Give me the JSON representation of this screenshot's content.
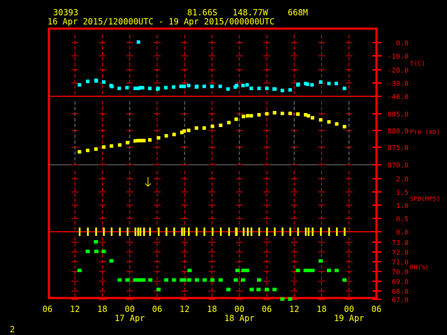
{
  "header": {
    "station": "30393",
    "lat": "81.66S",
    "lon": "148.77W",
    "elev": "668M",
    "period": "16 Apr 2015/120000UTC - 19 Apr 2015/000000UTC"
  },
  "footer": {
    "page": "2"
  },
  "colors": {
    "frame": "#ff0000",
    "temp": "#00ffff",
    "pressure": "#ffff00",
    "wind": "#ffff00",
    "rh": "#00ff00",
    "text": "#ffff00"
  },
  "chart_data": {
    "type": "scatter",
    "title": "30393  81.66S 148.77W 668M",
    "subtitle": "16 Apr 2015/120000UTC - 19 Apr 2015/000000UTC",
    "x_unit": "hours since 16 Apr 2015 06 UTC",
    "xlim": [
      0,
      72
    ],
    "x_ticks": [
      "06",
      "12",
      "18",
      "00",
      "06",
      "12",
      "18",
      "00",
      "06",
      "12",
      "18",
      "00",
      "06"
    ],
    "x_dates": [
      {
        "label": "17 Apr",
        "hour": 18
      },
      {
        "label": "18 Apr",
        "hour": 42
      },
      {
        "label": "19 Apr",
        "hour": 66
      }
    ],
    "panels": [
      {
        "name": "temperature",
        "label": "T(C)",
        "ylim": [
          -40,
          0
        ],
        "y_ticks": [
          "0.0",
          "-10.0",
          "-20.0",
          "-30.0",
          "-40.0"
        ],
        "x": [
          7.0,
          8.8,
          10.6,
          10.7,
          12.3,
          13.9,
          14.1,
          15.7,
          17.4,
          19.2,
          19.9,
          20.3,
          20.8,
          22.4,
          24.1,
          24.2,
          25.9,
          27.6,
          29.2,
          29.9,
          30.9,
          32.6,
          32.7,
          34.3,
          36.0,
          37.8,
          39.5,
          41.1,
          41.4,
          42.8,
          43.7,
          44.6,
          46.3,
          48.0,
          49.6,
          49.8,
          51.4,
          53.1,
          54.8,
          54.9,
          56.5,
          56.9,
          57.9,
          59.8,
          61.6,
          63.2,
          65.0,
          19.9
        ],
        "y": [
          -31.5,
          -28.9,
          -28.1,
          -28.6,
          -29.4,
          -32.0,
          -32.7,
          -34.1,
          -33.6,
          -34.1,
          -34.1,
          -33.6,
          -33.6,
          -34.1,
          -34.6,
          -34.1,
          -33.6,
          -33.1,
          -32.6,
          -32.6,
          -32.0,
          -33.1,
          -32.6,
          -32.6,
          -32.6,
          -32.6,
          -34.6,
          -33.1,
          -32.0,
          -32.0,
          -31.5,
          -34.1,
          -34.1,
          -34.1,
          -34.6,
          -34.6,
          -35.7,
          -35.2,
          -31.5,
          -31.0,
          -30.5,
          -31.0,
          -31.5,
          -29.4,
          -30.5,
          -30.5,
          -34.1,
          0.4
        ]
      },
      {
        "name": "pressure",
        "label": "Pre (mb)",
        "ylim": [
          870,
          888
        ],
        "y_ticks": [
          "885.0",
          "880.0",
          "875.0",
          "870.0"
        ],
        "x": [
          7.0,
          8.8,
          10.6,
          12.3,
          14.0,
          15.8,
          17.5,
          19.2,
          19.8,
          20.3,
          20.7,
          21.1,
          22.4,
          24.3,
          26.0,
          27.7,
          29.4,
          29.9,
          30.9,
          32.6,
          34.3,
          36.1,
          37.9,
          39.7,
          41.3,
          42.9,
          43.8,
          44.6,
          46.3,
          48.0,
          49.7,
          51.4,
          53.1,
          54.8,
          56.5,
          57.1,
          58.0,
          59.8,
          61.6,
          63.3,
          65.0
        ],
        "y": [
          873.8,
          874.2,
          874.6,
          875.2,
          875.5,
          875.8,
          876.5,
          877.0,
          877.1,
          877.1,
          877.1,
          877.1,
          877.3,
          877.9,
          878.5,
          878.9,
          879.5,
          879.9,
          880.1,
          880.8,
          880.8,
          881.3,
          881.6,
          882.4,
          883.4,
          884.2,
          884.4,
          884.4,
          884.7,
          885.0,
          885.3,
          885.1,
          885.1,
          884.9,
          884.7,
          884.4,
          883.8,
          883.2,
          882.6,
          882.0,
          881.2
        ]
      },
      {
        "name": "wind_speed",
        "label": "SPD(MPS)",
        "ylim": [
          0,
          2.5
        ],
        "y_ticks": [
          "2.0",
          "1.5",
          "1.0",
          "0.5",
          "0.0"
        ],
        "x": [
          7.0,
          8.8,
          10.6,
          12.3,
          14.0,
          15.8,
          17.5,
          19.2,
          19.8,
          20.3,
          21.1,
          22.4,
          24.3,
          26.0,
          27.7,
          29.4,
          29.9,
          30.9,
          32.6,
          34.3,
          36.1,
          37.9,
          39.7,
          41.2,
          41.4,
          42.9,
          43.8,
          44.6,
          46.3,
          48.0,
          49.7,
          51.4,
          53.1,
          54.8,
          56.5,
          57.1,
          58.0,
          59.8,
          61.6,
          63.3,
          65.0
        ],
        "y": [
          0,
          0,
          0,
          0,
          0,
          0,
          0,
          0,
          0,
          0,
          0,
          0,
          0,
          0,
          0,
          0,
          0,
          0,
          0,
          0,
          0,
          0,
          0,
          0,
          0,
          0,
          0,
          0,
          0,
          0,
          0,
          0,
          0,
          0,
          0,
          0,
          0,
          0,
          0,
          0,
          0
        ],
        "direction_arrow": {
          "x": 22.0,
          "y": 1.9,
          "pointing": "down"
        }
      },
      {
        "name": "relative_humidity",
        "label": "RH(%)",
        "ylim": [
          67,
          74
        ],
        "y_ticks": [
          "73.0",
          "72.0",
          "71.0",
          "70.0",
          "69.0",
          "68.0",
          "67.0"
        ],
        "x": [
          7.0,
          8.8,
          10.6,
          10.7,
          12.3,
          14.0,
          15.8,
          17.5,
          19.2,
          19.8,
          20.4,
          21.0,
          22.5,
          24.3,
          26.0,
          27.7,
          29.4,
          29.9,
          31.0,
          31.1,
          32.7,
          34.4,
          36.1,
          37.9,
          39.6,
          41.2,
          41.6,
          42.9,
          43.7,
          42.8,
          44.7,
          46.3,
          46.2,
          48.0,
          49.7,
          51.4,
          53.1,
          54.8,
          56.5,
          57.1,
          58.0,
          59.8,
          61.6,
          63.3,
          65.0
        ],
        "y": [
          70,
          72,
          73,
          72,
          72,
          71,
          69,
          69,
          69,
          69,
          69,
          69,
          69,
          68,
          69,
          69,
          69,
          69,
          69,
          70,
          69,
          69,
          69,
          69,
          68,
          69,
          70,
          70,
          70,
          69,
          68,
          69,
          68,
          68,
          68,
          67,
          67,
          70,
          70,
          70,
          70,
          71,
          70,
          70,
          69
        ]
      }
    ]
  }
}
